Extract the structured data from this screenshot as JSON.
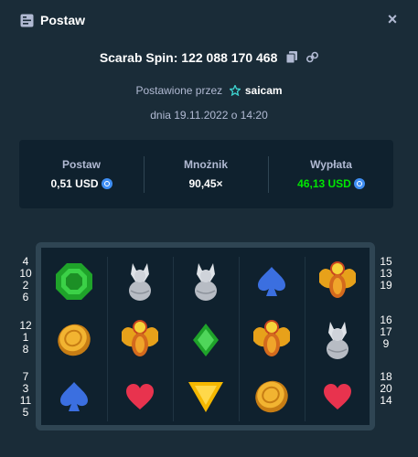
{
  "header": {
    "title": "Postaw",
    "close_label": "×"
  },
  "game": {
    "line": "Scarab Spin: 122 088 170 468"
  },
  "placed_by": {
    "prefix": "Postawione przez",
    "user": "saicam"
  },
  "date": "dnia 19.11.2022 o 14:20",
  "stats": {
    "bet": {
      "label": "Postaw",
      "value": "0,51 USD"
    },
    "multiplier": {
      "label": "Mnożnik",
      "value": "90,45×"
    },
    "payout": {
      "label": "Wypłata",
      "value": "46,13 USD"
    }
  },
  "reels": {
    "rows": [
      [
        "green-gem-icon",
        "wolf-icon",
        "wolf-icon",
        "spade-icon",
        "scarab-icon"
      ],
      [
        "coin-icon",
        "scarab-icon",
        "green-diamond-icon",
        "scarab-icon",
        "wolf-icon"
      ],
      [
        "spade-icon",
        "heart-icon",
        "yellow-triangle-gem-icon",
        "coin-icon",
        "heart-icon"
      ]
    ]
  },
  "paylines_left": [
    [
      "4",
      "10",
      "2",
      "6"
    ],
    [
      "12",
      "1",
      "8"
    ],
    [
      "7",
      "3",
      "11",
      "5"
    ]
  ],
  "paylines_right": [
    [
      "15",
      "13",
      "19"
    ],
    [
      "16",
      "17",
      "9"
    ],
    [
      "18",
      "20",
      "14"
    ]
  ],
  "colors": {
    "background": "#1a2c38",
    "panel": "#0f212e",
    "payout_green": "#00e701",
    "muted": "#b1bad3"
  }
}
